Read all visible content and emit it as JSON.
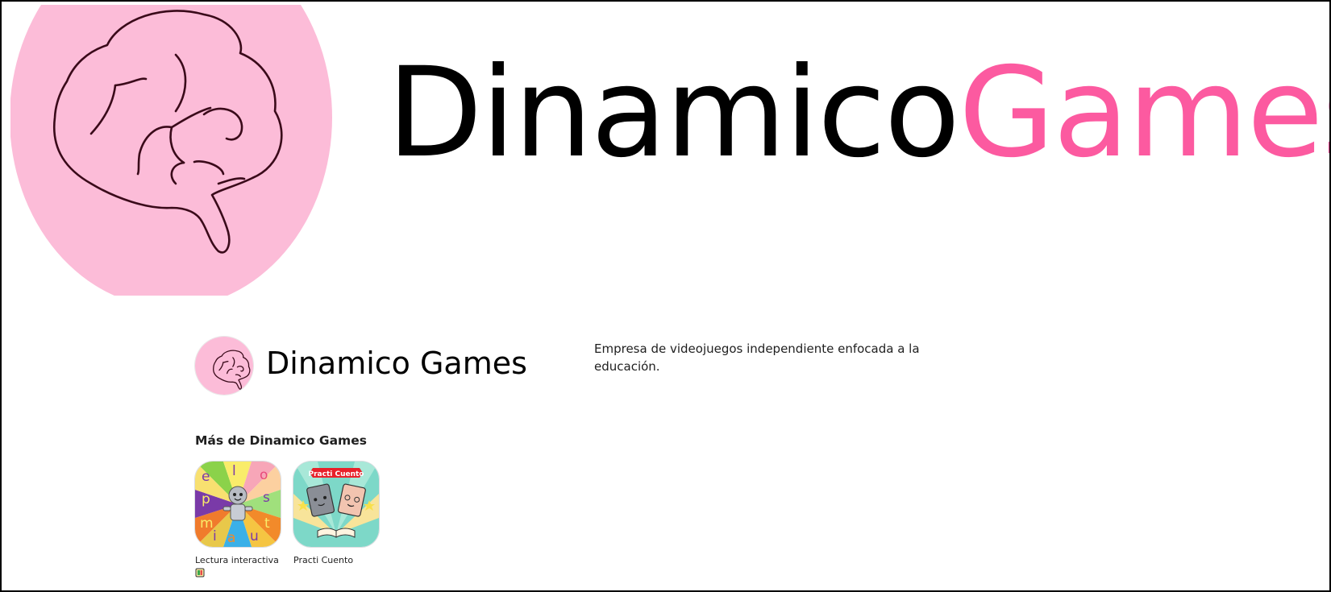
{
  "banner": {
    "wordmark_dark": "Dinamico",
    "wordmark_pink": "Games",
    "logo_icon": "brain-icon",
    "colors": {
      "logo_background": "#fcbcd8",
      "logo_stroke": "#3a0a1a",
      "wordmark_dark": "#000000",
      "wordmark_pink": "#fc5aa0"
    }
  },
  "developer": {
    "name": "Dinamico Games",
    "description": "Empresa de videojuegos independiente enfocada a la educación.",
    "avatar_icon": "brain-icon"
  },
  "more_section": {
    "title": "Más de Dinamico Games",
    "apps": [
      {
        "name": "Lectura interactiva",
        "icon": "lectura-interactiva-app-icon",
        "badge_icon": "book-badge-icon",
        "letters": [
          "e",
          "l",
          "o",
          "p",
          "s",
          "m",
          "i",
          "a",
          "u",
          "t"
        ]
      },
      {
        "name": "Practi Cuento",
        "icon": "practi-cuento-app-icon",
        "banner_text": "Practi Cuento"
      }
    ]
  }
}
